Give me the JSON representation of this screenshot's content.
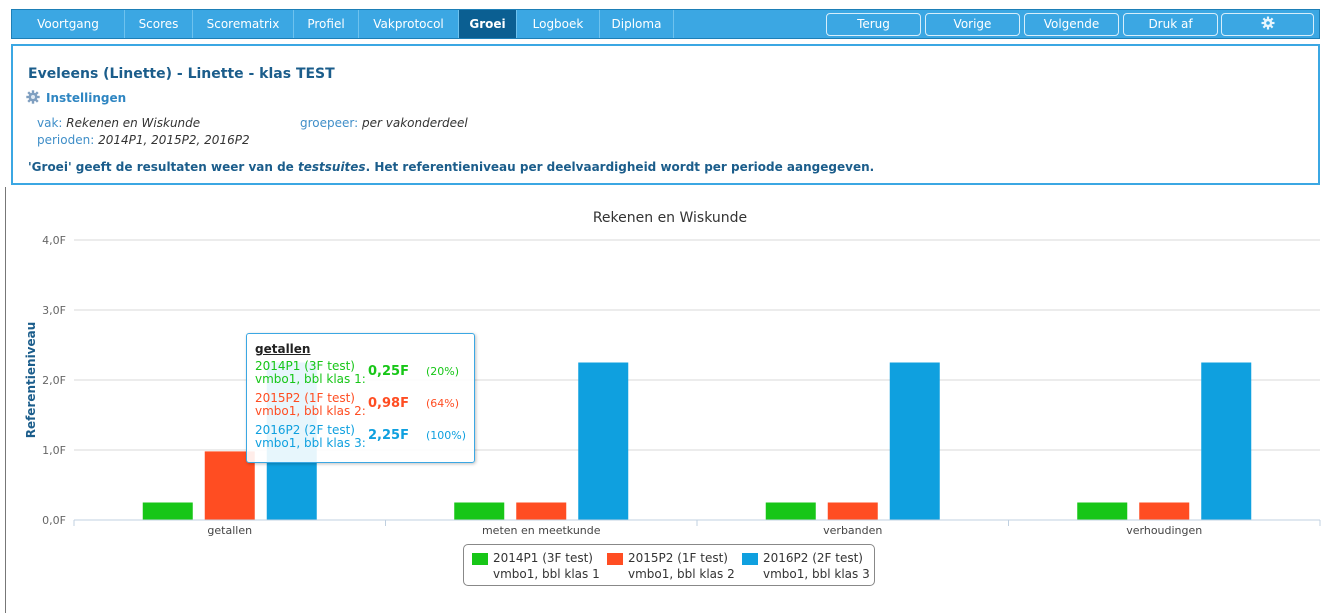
{
  "nav": {
    "tabs": [
      "Voortgang",
      "Scores",
      "Scorematrix",
      "Profiel",
      "Vakprotocol",
      "Groei",
      "Logboek",
      "Diploma"
    ],
    "active_tab": "Groei",
    "buttons": [
      "Terug",
      "Vorige",
      "Volgende",
      "Druk af"
    ],
    "settings_icon": "gear-icon"
  },
  "info": {
    "student": "Eveleens (Linette) - Linette - klas TEST",
    "settings_label": "Instellingen",
    "vak_label": "vak:",
    "vak_value": "Rekenen en Wiskunde",
    "groepeer_label": "groepeer:",
    "groepeer_value": "per vakonderdeel",
    "perioden_label": "perioden:",
    "perioden_value": "2014P1, 2015P2, 2016P2",
    "description_pre": "'Groei' geeft de resultaten weer van de ",
    "description_em": "testsuites",
    "description_post": ". Het referentieniveau per deelvaardigheid wordt per periode aangegeven."
  },
  "chart_data": {
    "type": "bar",
    "title": "Rekenen en Wiskunde",
    "ylabel": "Referentieniveau",
    "xlabel": "",
    "ylim": [
      0,
      4
    ],
    "yticks": [
      "0,0F",
      "1,0F",
      "2,0F",
      "3,0F",
      "4,0F"
    ],
    "grid": true,
    "legend_position": "bottom",
    "categories": [
      "getallen",
      "meten en meetkunde",
      "verbanden",
      "verhoudingen"
    ],
    "series": [
      {
        "name": "2014P1 (3F test)",
        "sub": "vmbo1, bbl klas 1",
        "color": "#17c617",
        "values": [
          0.25,
          0.25,
          0.25,
          0.25
        ]
      },
      {
        "name": "2015P2 (1F test)",
        "sub": "vmbo1, bbl klas 2",
        "color": "#ff4d22",
        "values": [
          0.98,
          0.25,
          0.25,
          0.25
        ]
      },
      {
        "name": "2016P2 (2F test)",
        "sub": "vmbo1, bbl klas 3",
        "color": "#0fa0df",
        "values": [
          2.25,
          2.25,
          2.25,
          2.25
        ]
      }
    ],
    "tooltip": {
      "title": "getallen",
      "rows": [
        {
          "line1": "2014P1 (3F test)",
          "line2": "vmbo1, bbl klas 1:",
          "value": "0,25F",
          "pct": "(20%)",
          "color": "#17c617"
        },
        {
          "line1": "2015P2 (1F test)",
          "line2": "vmbo1, bbl klas 2:",
          "value": "0,98F",
          "pct": "(64%)",
          "color": "#ff4d22"
        },
        {
          "line1": "2016P2 (2F test)",
          "line2": "vmbo1, bbl klas 3:",
          "value": "2,25F",
          "pct": "(100%)",
          "color": "#0fa0df"
        }
      ]
    }
  }
}
